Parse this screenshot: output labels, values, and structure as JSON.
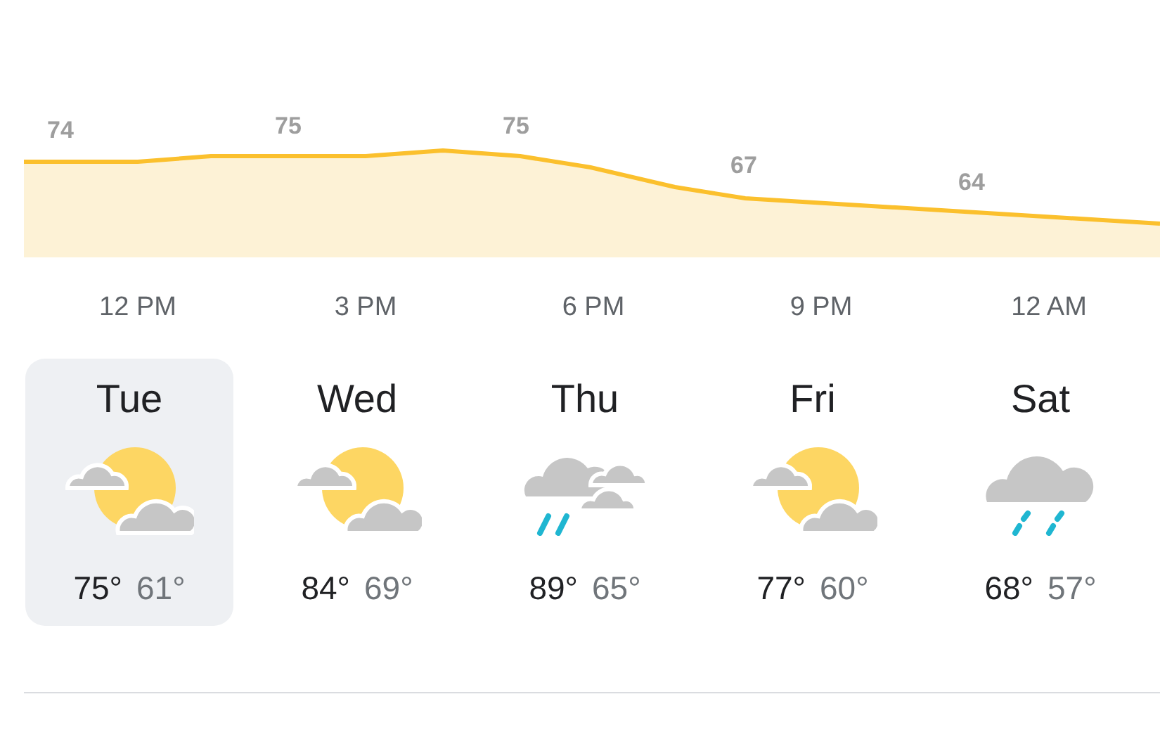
{
  "hourly": {
    "temps": [
      "74",
      "75",
      "75",
      "67",
      "64"
    ],
    "times": [
      "12 PM",
      "3 PM",
      "6 PM",
      "9 PM",
      "12 AM"
    ]
  },
  "days": [
    {
      "day": "Tue",
      "kind": "partly-cloudy",
      "high": "75°",
      "low": "61°",
      "selected": true
    },
    {
      "day": "Wed",
      "kind": "partly-cloudy",
      "high": "84°",
      "low": "69°",
      "selected": false
    },
    {
      "day": "Thu",
      "kind": "showers",
      "high": "89°",
      "low": "65°",
      "selected": false
    },
    {
      "day": "Fri",
      "kind": "partly-cloudy",
      "high": "77°",
      "low": "60°",
      "selected": false
    },
    {
      "day": "Sat",
      "kind": "rain",
      "high": "68°",
      "low": "57°",
      "selected": false
    }
  ]
}
